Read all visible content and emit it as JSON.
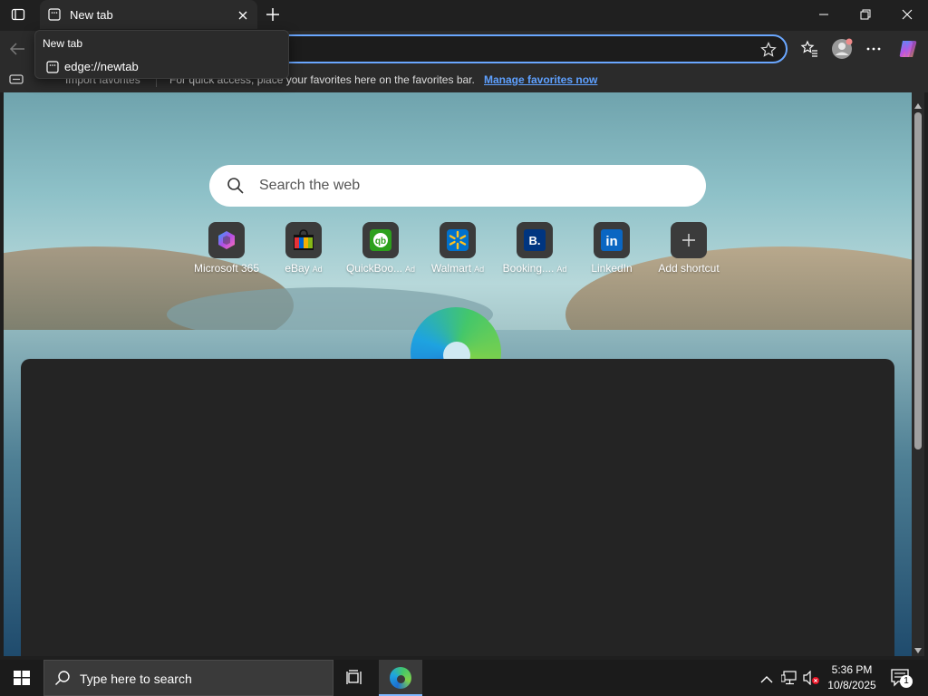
{
  "browser": {
    "tab_title": "New tab",
    "popup": {
      "title": "New tab",
      "url": "edge://newtab"
    },
    "favorites_bar": {
      "import_label": "Import favorites",
      "message": "For quick access, place your favorites here on the favorites bar.",
      "manage_link": "Manage favorites now"
    }
  },
  "newtab": {
    "search_placeholder": "Search the web",
    "shortcuts": [
      {
        "label": "Microsoft 365",
        "ad": ""
      },
      {
        "label": "eBay",
        "ad": "Ad"
      },
      {
        "label": "QuickBoo...",
        "ad": "Ad"
      },
      {
        "label": "Walmart",
        "ad": "Ad"
      },
      {
        "label": "Booking....",
        "ad": "Ad"
      },
      {
        "label": "LinkedIn",
        "ad": ""
      },
      {
        "label": "Add shortcut",
        "ad": ""
      }
    ]
  },
  "taskbar": {
    "search_placeholder": "Type here to search",
    "time": "5:36 PM",
    "date": "10/8/2025",
    "notification_count": "1"
  },
  "colors": {
    "accent": "#6aa7ff",
    "link": "#5ea0ff"
  },
  "icons": [
    "sidebar-toggle-icon",
    "tab-page-icon",
    "close-icon",
    "plus-icon",
    "minimize-icon",
    "restore-icon",
    "back-icon",
    "star-icon",
    "favorites-icon",
    "profile-icon",
    "more-icon",
    "copilot-icon",
    "search-icon",
    "windows-icon",
    "task-view-icon",
    "edge-icon",
    "chevron-up-icon",
    "network-icon",
    "volume-muted-icon",
    "notification-icon"
  ]
}
